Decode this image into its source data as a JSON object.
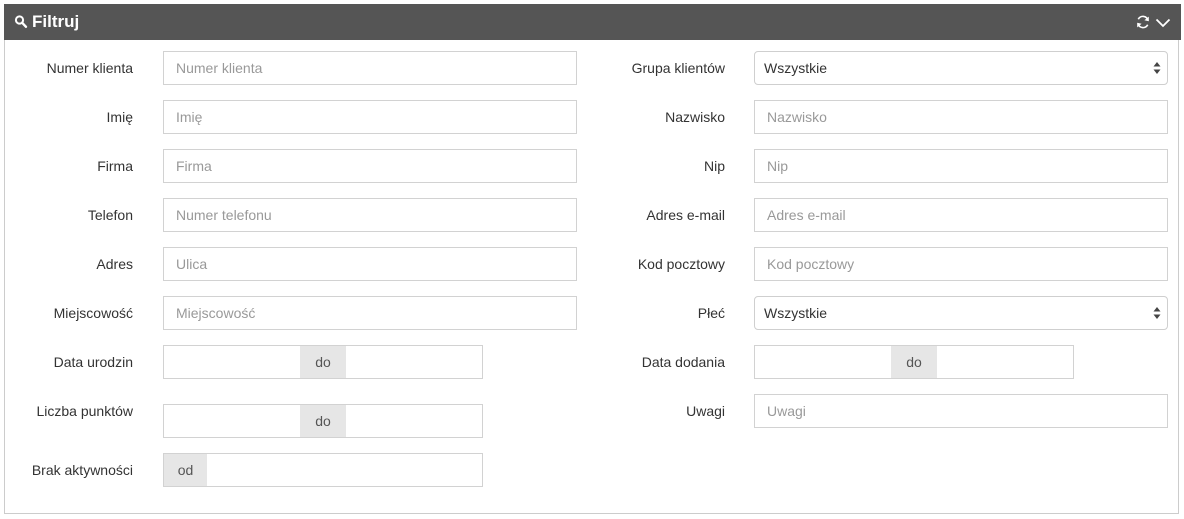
{
  "panel": {
    "title": "Filtruj",
    "header_icons": [
      "search-icon",
      "refresh-icon",
      "chevron-down-icon"
    ]
  },
  "left_fields": {
    "numer_klienta": {
      "label": "Numer klienta",
      "placeholder": "Numer klienta",
      "value": ""
    },
    "imie": {
      "label": "Imię",
      "placeholder": "Imię",
      "value": ""
    },
    "firma": {
      "label": "Firma",
      "placeholder": "Firma",
      "value": ""
    },
    "telefon": {
      "label": "Telefon",
      "placeholder": "Numer telefonu",
      "value": ""
    },
    "adres": {
      "label": "Adres",
      "placeholder": "Ulica",
      "value": ""
    },
    "miejscowosc": {
      "label": "Miejscowość",
      "placeholder": "Miejscowość",
      "value": ""
    },
    "data_urodzin": {
      "label": "Data urodzin",
      "separator": "do",
      "from": "",
      "to": ""
    },
    "liczba_punktow": {
      "label": "Liczba punktów",
      "separator": "do",
      "from": "",
      "to": ""
    },
    "brak_aktywnosci": {
      "label": "Brak aktywności",
      "prefix": "od",
      "value": ""
    }
  },
  "right_fields": {
    "grupa_klientow": {
      "label": "Grupa klientów",
      "selected": "Wszystkie"
    },
    "nazwisko": {
      "label": "Nazwisko",
      "placeholder": "Nazwisko",
      "value": ""
    },
    "nip": {
      "label": "Nip",
      "placeholder": "Nip",
      "value": ""
    },
    "email": {
      "label": "Adres e-mail",
      "placeholder": "Adres e-mail",
      "value": ""
    },
    "kod_pocztowy": {
      "label": "Kod pocztowy",
      "placeholder": "Kod pocztowy",
      "value": ""
    },
    "plec": {
      "label": "Płeć",
      "selected": "Wszystkie"
    },
    "data_dodania": {
      "label": "Data dodania",
      "separator": "do",
      "from": "",
      "to": ""
    },
    "uwagi": {
      "label": "Uwagi",
      "placeholder": "Uwagi",
      "value": ""
    }
  },
  "colors": {
    "header_bg": "#555555",
    "header_text": "#ffffff",
    "input_border": "#d2d2d2",
    "addon_bg": "#e6e6e6",
    "placeholder": "#999999"
  }
}
